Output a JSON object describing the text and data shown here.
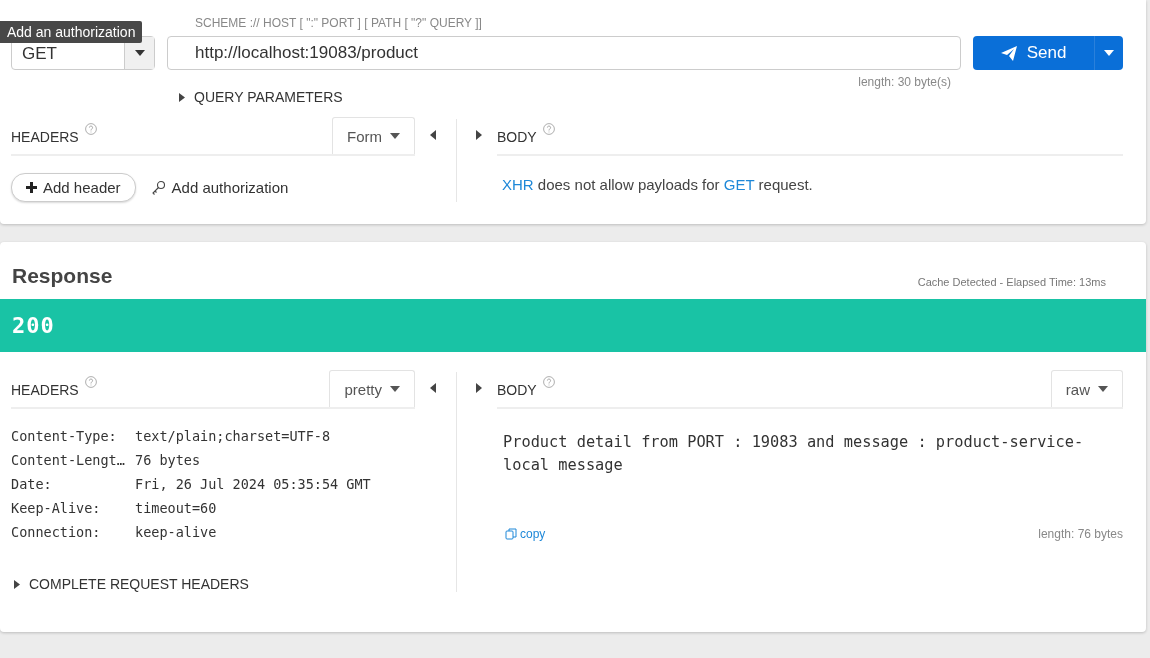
{
  "tooltip": "Add an authorization",
  "request": {
    "method": "GET",
    "url_hint": "SCHEME :// HOST [ \":\" PORT ] [ PATH [ \"?\" QUERY ]]",
    "url": "http://localhost:19083/product",
    "length": "length: 30 byte(s)",
    "send": "Send",
    "query_parameters": {
      "label": "QUERY PARAMETERS",
      "expanded": false
    },
    "headers": {
      "title": "HEADERS",
      "mode": "Form",
      "add_header": "Add header",
      "add_authorization": "Add authorization"
    },
    "body": {
      "title": "BODY",
      "message": [
        {
          "kind": "link",
          "text": "XHR"
        },
        {
          "kind": "text",
          "text": " does not allow payloads for "
        },
        {
          "kind": "link",
          "text": "GET"
        },
        {
          "kind": "text",
          "text": " request."
        }
      ]
    }
  },
  "response": {
    "title": "Response",
    "meta": "Cache Detected - Elapsed Time: 13ms",
    "status": "200",
    "headers": {
      "title": "HEADERS",
      "format": "pretty",
      "rows": [
        {
          "name": "Content-Type:",
          "value": "text/plain;charset=UTF-8"
        },
        {
          "name": "Content-Lengt…",
          "value": "76 bytes"
        },
        {
          "name": "Date:",
          "value": "Fri, 26 Jul 2024 05:35:54 GMT"
        },
        {
          "name": "Keep-Alive:",
          "value": "timeout=60"
        },
        {
          "name": "Connection:",
          "value": "keep-alive"
        }
      ],
      "complete": {
        "label": "COMPLETE REQUEST HEADERS",
        "expanded": false
      }
    },
    "body": {
      "title": "BODY",
      "format": "raw",
      "content": "Product detail from PORT : 19083 and message : product-service-local message",
      "copy": "copy",
      "length": "length: 76 bytes"
    }
  }
}
